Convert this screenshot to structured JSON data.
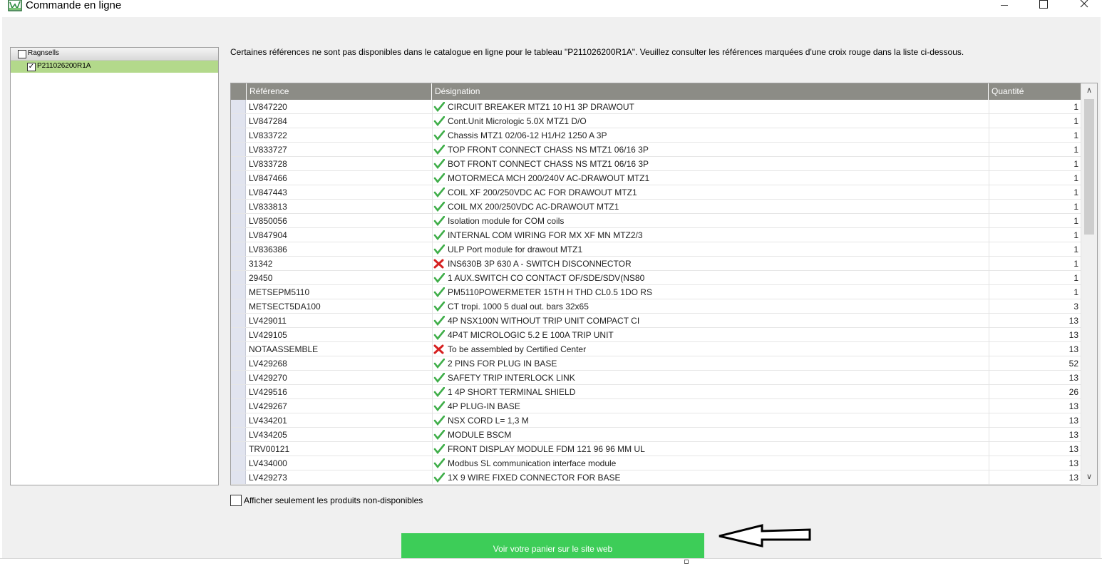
{
  "window": {
    "title": "Commande en ligne",
    "icon": "app-icon"
  },
  "tree": {
    "root": {
      "label": "Ragnsells",
      "checked": false
    },
    "child": {
      "label": "P211026200R1A",
      "checked": true,
      "check_mark": "✓"
    }
  },
  "info_message": "Certaines références ne sont pas disponibles dans le catalogue en ligne pour le tableau \"P211026200R1A\". Veuillez consulter les références marquées d'une croix rouge dans la liste ci-dessous.",
  "grid": {
    "columns": [
      "Référence",
      "Désignation",
      "Quantité"
    ],
    "rows": [
      {
        "ref": "LV847220",
        "desig": "CIRCUIT BREAKER MTZ1 10 H1 3P DRAWOUT",
        "qty": "1",
        "available": true
      },
      {
        "ref": "LV847284",
        "desig": "Cont.Unit Micrologic 5.0X MTZ1 D/O",
        "qty": "1",
        "available": true
      },
      {
        "ref": "LV833722",
        "desig": "Chassis MTZ1 02/06-12 H1/H2 1250 A 3P",
        "qty": "1",
        "available": true
      },
      {
        "ref": "LV833727",
        "desig": "TOP FRONT CONNECT CHASS NS MTZ1 06/16 3P",
        "qty": "1",
        "available": true
      },
      {
        "ref": "LV833728",
        "desig": "BOT FRONT CONNECT CHASS NS MTZ1 06/16 3P",
        "qty": "1",
        "available": true
      },
      {
        "ref": "LV847466",
        "desig": "MOTORMECA MCH 200/240V AC-DRAWOUT MTZ1",
        "qty": "1",
        "available": true
      },
      {
        "ref": "LV847443",
        "desig": "COIL XF 200/250VDC AC FOR DRAWOUT MTZ1",
        "qty": "1",
        "available": true
      },
      {
        "ref": "LV833813",
        "desig": "COIL MX 200/250VDC AC-DRAWOUT MTZ1",
        "qty": "1",
        "available": true
      },
      {
        "ref": "LV850056",
        "desig": "Isolation module for COM coils",
        "qty": "1",
        "available": true
      },
      {
        "ref": "LV847904",
        "desig": "INTERNAL COM WIRING FOR MX XF MN MTZ2/3",
        "qty": "1",
        "available": true
      },
      {
        "ref": "LV836386",
        "desig": "ULP Port module for drawout MTZ1",
        "qty": "1",
        "available": true
      },
      {
        "ref": "31342",
        "desig": "INS630B 3P 630 A - SWITCH DISCONNECTOR",
        "qty": "1",
        "available": false
      },
      {
        "ref": "29450",
        "desig": "1 AUX.SWITCH CO CONTACT OF/SDE/SDV(NS80",
        "qty": "1",
        "available": true
      },
      {
        "ref": "METSEPM5110",
        "desig": "PM5110POWERMETER 15TH H THD CL0.5 1DO RS",
        "qty": "1",
        "available": true
      },
      {
        "ref": "METSECT5DA100",
        "desig": "CT tropi. 1000 5 dual out. bars 32x65",
        "qty": "3",
        "available": true
      },
      {
        "ref": "LV429011",
        "desig": "4P NSX100N WITHOUT TRIP UNIT COMPACT CI",
        "qty": "13",
        "available": true
      },
      {
        "ref": "LV429105",
        "desig": "4P4T MICROLOGIC 5.2 E 100A TRIP UNIT",
        "qty": "13",
        "available": true
      },
      {
        "ref": "NOTAASSEMBLE",
        "desig": "To be assembled by Certified Center",
        "qty": "13",
        "available": false
      },
      {
        "ref": "LV429268",
        "desig": "2 PINS FOR PLUG IN BASE",
        "qty": "52",
        "available": true
      },
      {
        "ref": "LV429270",
        "desig": "SAFETY TRIP INTERLOCK LINK",
        "qty": "13",
        "available": true
      },
      {
        "ref": "LV429516",
        "desig": "1 4P SHORT TERMINAL SHIELD",
        "qty": "26",
        "available": true
      },
      {
        "ref": "LV429267",
        "desig": "4P PLUG-IN BASE",
        "qty": "13",
        "available": true
      },
      {
        "ref": "LV434201",
        "desig": "NSX CORD L= 1,3 M",
        "qty": "13",
        "available": true
      },
      {
        "ref": "LV434205",
        "desig": "MODULE BSCM",
        "qty": "13",
        "available": true
      },
      {
        "ref": "TRV00121",
        "desig": "FRONT DISPLAY MODULE FDM 121 96 96 MM UL",
        "qty": "13",
        "available": true
      },
      {
        "ref": "LV434000",
        "desig": "Modbus SL communication interface module",
        "qty": "13",
        "available": true
      },
      {
        "ref": "LV429273",
        "desig": "1X 9 WIRE FIXED CONNECTOR FOR BASE",
        "qty": "13",
        "available": true
      }
    ],
    "scroll_up": "∧",
    "scroll_down": "∨"
  },
  "filter": {
    "label": "Afficher seulement les produits non-disponibles",
    "checked": false
  },
  "web_button": {
    "label": "Voir votre panier sur le site web",
    "color": "#3dcd58"
  },
  "colors": {
    "header_bg": "#8c8c86",
    "tree_selected": "#b3d98b",
    "check_green": "#3fae49",
    "cross_red": "#d62020"
  }
}
